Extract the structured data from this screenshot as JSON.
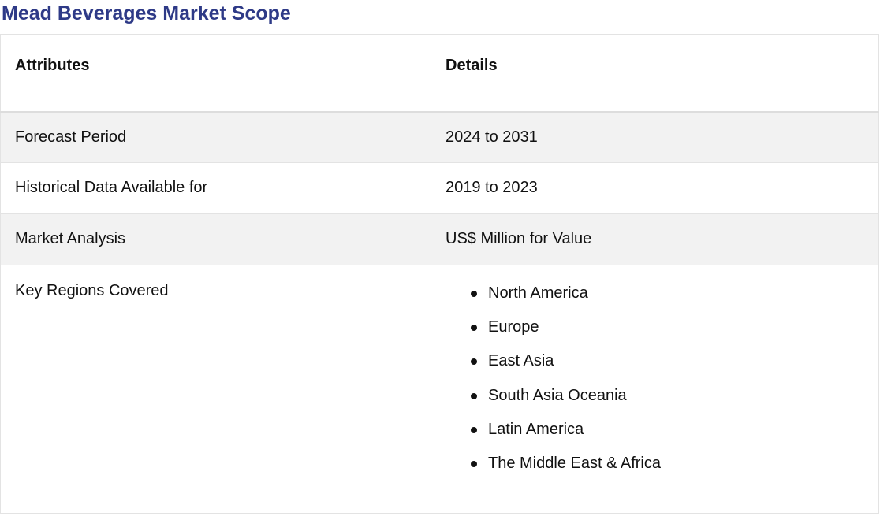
{
  "page": {
    "title": "Mead Beverages Market Scope"
  },
  "table": {
    "headers": [
      "Attributes",
      "Details"
    ],
    "rows": [
      {
        "attribute": "Forecast Period",
        "detail": "2024 to 2031"
      },
      {
        "attribute": "Historical Data Available for",
        "detail": "2019 to 2023"
      },
      {
        "attribute": "Market Analysis",
        "detail": "US$ Million for Value"
      },
      {
        "attribute": "Key Regions Covered",
        "detail_list": [
          "North America",
          "Europe",
          "East Asia",
          "South Asia Oceania",
          "Latin America",
          "The Middle East & Africa"
        ]
      }
    ]
  },
  "colors": {
    "title": "#2e3a87",
    "row_shade": "#f2f2f2",
    "border": "#e3e3e3"
  }
}
